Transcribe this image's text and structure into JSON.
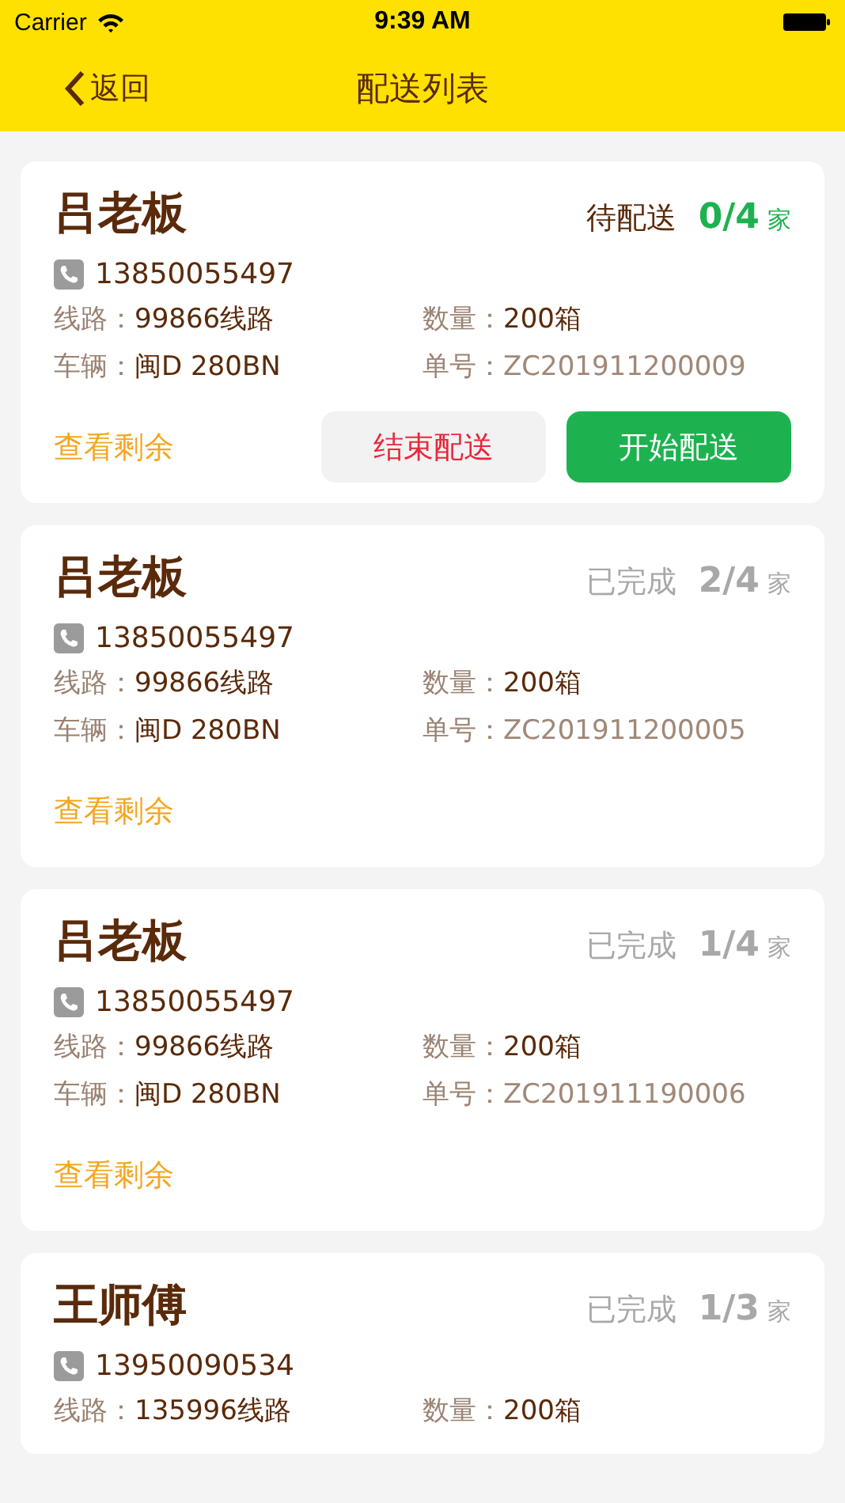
{
  "status_bar": {
    "carrier": "Carrier",
    "time": "9:39 AM"
  },
  "nav": {
    "back": "返回",
    "title": "配送列表"
  },
  "orders": [
    {
      "name": "吕老板",
      "status": "待配送",
      "kind": "pending",
      "count": "0/4",
      "unit": "家",
      "phone": "13850055497",
      "fields": [
        {
          "label": "线路：",
          "value": "99866线路"
        },
        {
          "label": "数量：",
          "value": "200箱"
        },
        {
          "label": "车辆：",
          "value": "闽D 280BN"
        },
        {
          "label": "单号：",
          "value": "ZC201911200009"
        }
      ],
      "link": "查看剩余",
      "buttons": [
        {
          "label": "结束配送",
          "kind": "end"
        },
        {
          "label": "开始配送",
          "kind": "start"
        }
      ]
    },
    {
      "name": "吕老板",
      "status": "已完成",
      "kind": "done",
      "count": "2/4",
      "unit": "家",
      "phone": "13850055497",
      "fields": [
        {
          "label": "线路：",
          "value": "99866线路"
        },
        {
          "label": "数量：",
          "value": "200箱"
        },
        {
          "label": "车辆：",
          "value": "闽D 280BN"
        },
        {
          "label": "单号：",
          "value": "ZC201911200005"
        }
      ],
      "link": "查看剩余"
    },
    {
      "name": "吕老板",
      "status": "已完成",
      "kind": "done",
      "count": "1/4",
      "unit": "家",
      "phone": "13850055497",
      "fields": [
        {
          "label": "线路：",
          "value": "99866线路"
        },
        {
          "label": "数量：",
          "value": "200箱"
        },
        {
          "label": "车辆：",
          "value": "闽D 280BN"
        },
        {
          "label": "单号：",
          "value": "ZC201911190006"
        }
      ],
      "link": "查看剩余"
    },
    {
      "name": "王师傅",
      "status": "已完成",
      "kind": "done",
      "count": "1/3",
      "unit": "家",
      "phone": "13950090534",
      "fields": [
        {
          "label": "线路：",
          "value": "135996线路"
        },
        {
          "label": "数量：",
          "value": "200箱"
        }
      ]
    }
  ]
}
